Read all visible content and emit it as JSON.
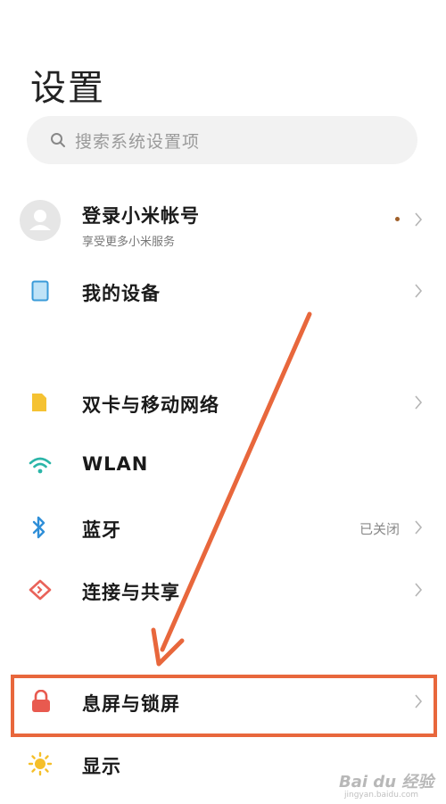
{
  "header": {
    "title": "设置"
  },
  "search": {
    "placeholder": "搜索系统设置项"
  },
  "account": {
    "title": "登录小米帐号",
    "subtitle": "享受更多小米服务"
  },
  "items": [
    {
      "label": "我的设备",
      "icon": "device-icon"
    },
    {
      "label": "双卡与移动网络",
      "icon": "sim-card-icon"
    },
    {
      "label": "WLAN",
      "icon": "wifi-icon"
    },
    {
      "label": "蓝牙",
      "icon": "bluetooth-icon",
      "status": "已关闭"
    },
    {
      "label": "连接与共享",
      "icon": "share-icon"
    },
    {
      "label": "息屏与锁屏",
      "icon": "lock-icon"
    },
    {
      "label": "显示",
      "icon": "sun-icon"
    }
  ],
  "annotation": {
    "color": "#e8673c"
  },
  "watermark": {
    "text": "Bai du 经验",
    "sub": "jingyan.baidu.com"
  }
}
